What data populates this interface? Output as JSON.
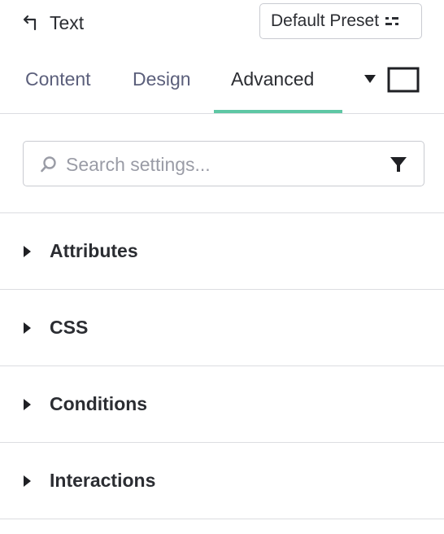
{
  "header": {
    "title": "Text",
    "preset_label": "Default Preset"
  },
  "tabs": [
    {
      "label": "Content",
      "active": false
    },
    {
      "label": "Design",
      "active": false
    },
    {
      "label": "Advanced",
      "active": true
    }
  ],
  "colors": {
    "accent_underline": "#5ec7a4",
    "text_primary": "#2b2d32",
    "tab_inactive": "#5b5f7b",
    "border": "#c9cbd1"
  },
  "search": {
    "placeholder": "Search settings...",
    "value": ""
  },
  "sections": [
    {
      "label": "Attributes"
    },
    {
      "label": "CSS"
    },
    {
      "label": "Conditions"
    },
    {
      "label": "Interactions"
    }
  ],
  "icons": {
    "back": "back-arrow-icon",
    "preset": "preset-options-icon",
    "dropdown": "caret-down-icon",
    "responsive": "desktop-view-icon",
    "search": "search-icon",
    "filter": "filter-icon",
    "section_toggle": "caret-right-icon"
  }
}
